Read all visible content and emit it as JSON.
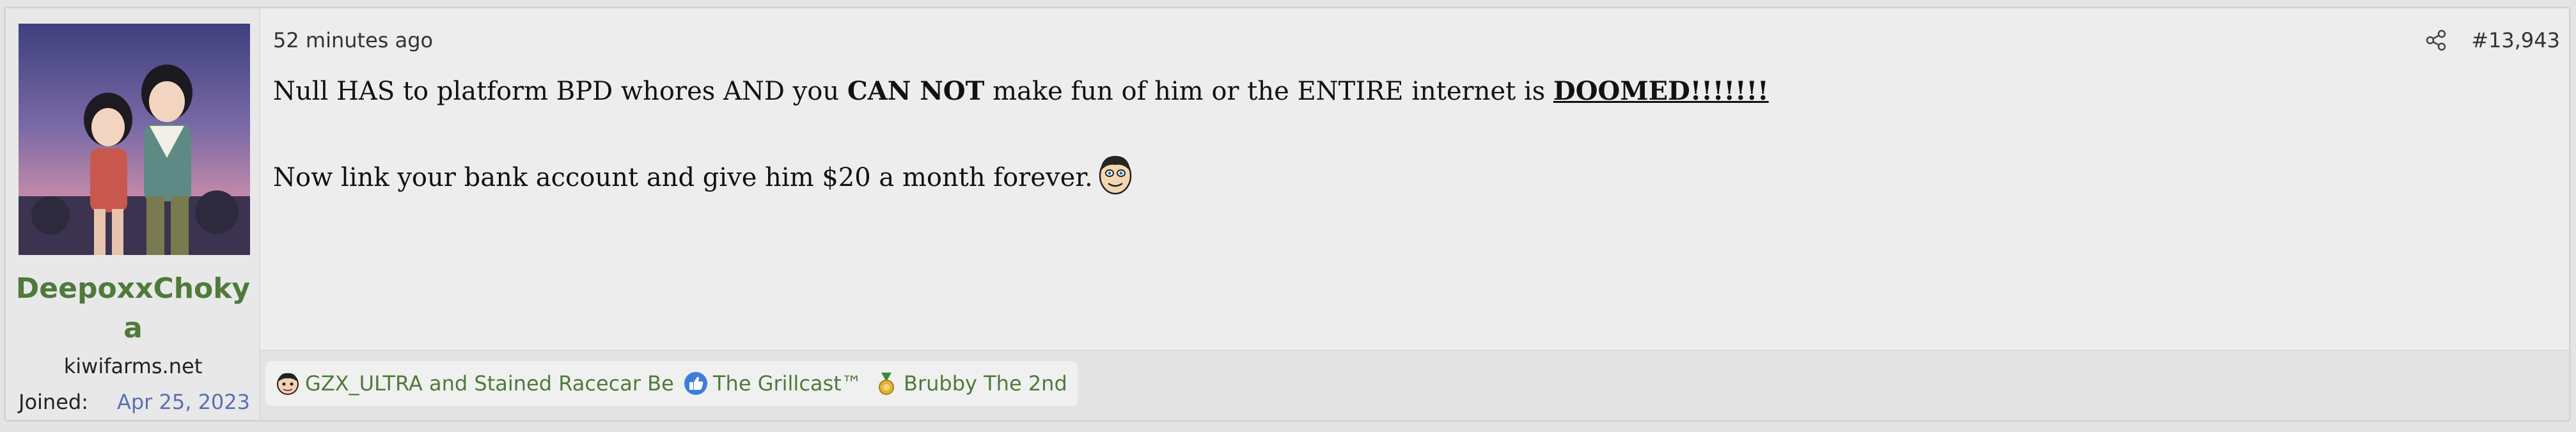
{
  "user": {
    "name": "DeepoxxChokya",
    "title": "kiwifarms.net",
    "joined_label": "Joined:",
    "joined_date": "Apr 25, 2023"
  },
  "post": {
    "time": "52 minutes ago",
    "number": "#13,943",
    "line1": {
      "a": "Null HAS to platform BPD whores AND you ",
      "b": "CAN NOT",
      "c": " make fun of him or the ENTIRE internet is ",
      "d": "DOOMED!!!!!!!"
    },
    "line2": "Now link your bank account and give him $20 a month forever."
  },
  "reactions": [
    {
      "label": "GZX_ULTRA and Stained Racecar Bed",
      "icon": "face-icon"
    },
    {
      "label": "The Grillcast™",
      "icon": "thumbs-up-icon"
    },
    {
      "label": "Brubby The 2nd",
      "icon": "medal-icon"
    }
  ],
  "colors": {
    "username": "#4f7a3b",
    "joined_date": "#5a6fb5",
    "reaction_text": "#4f7a3b"
  }
}
